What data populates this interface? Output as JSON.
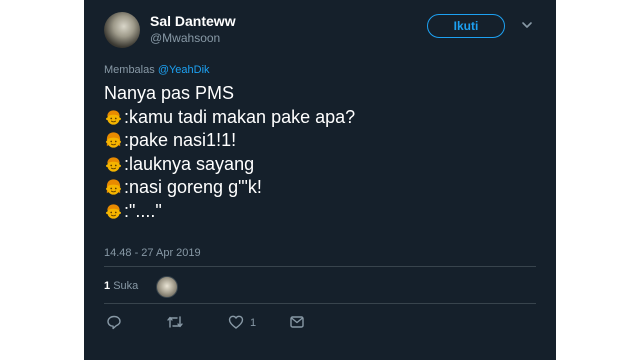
{
  "tweet": {
    "display_name": "Sal Danteww",
    "handle": "@Mwahsoon",
    "follow_label": "Ikuti",
    "reply_prefix": "Membalas",
    "reply_mention": "@YeahDik",
    "lines": [
      {
        "emoji": null,
        "text": "Nanya pas PMS"
      },
      {
        "emoji": "boy-face",
        "text": ":kamu tadi makan pake apa?"
      },
      {
        "emoji": "girl-face",
        "text": ":pake nasi1!1!"
      },
      {
        "emoji": "boy-face",
        "text": ":lauknya sayang"
      },
      {
        "emoji": "girl-face",
        "text": ":nasi goreng g\"'k!"
      },
      {
        "emoji": "boy-face",
        "text": ":\"....\""
      }
    ],
    "timestamp": "14.48 - 27 Apr 2019",
    "likes_count": "1",
    "likes_label": "Suka",
    "like_action_count": "1"
  },
  "colors": {
    "background": "#15202b",
    "accent": "#1da1f2",
    "muted": "#8899a6",
    "divider": "#38444d",
    "emoji_fill": "#f4b400",
    "emoji_hair": "#e88a00"
  },
  "icons": [
    "chevron-down-icon",
    "boy-face-icon",
    "girl-face-icon",
    "reply-icon",
    "retweet-icon",
    "heart-icon",
    "message-icon"
  ]
}
